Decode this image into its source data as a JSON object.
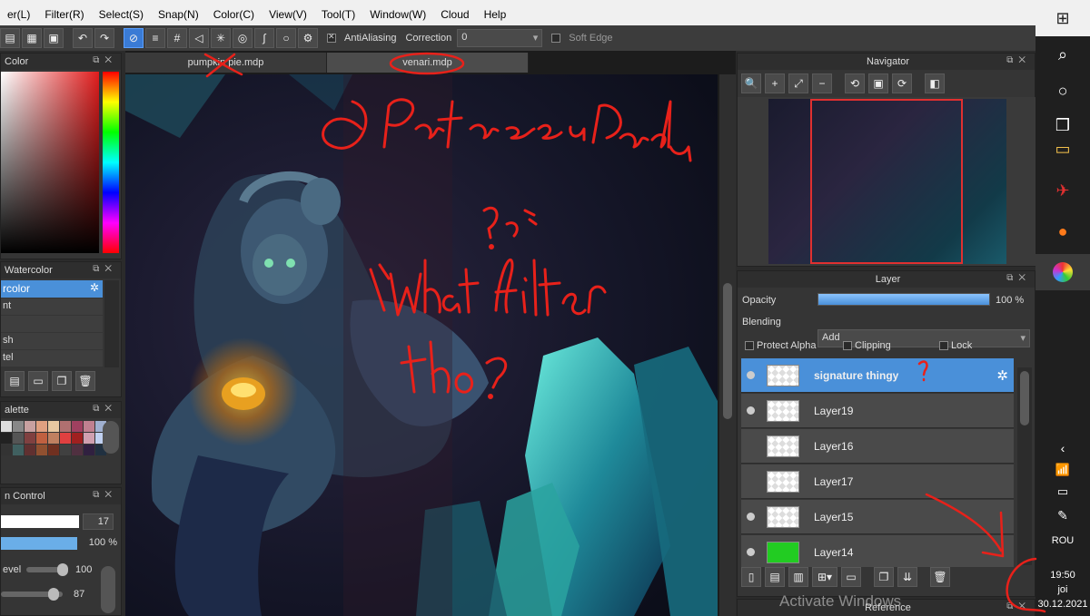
{
  "menu": [
    "er(L)",
    "Filter(R)",
    "Select(S)",
    "Snap(N)",
    "Color(C)",
    "View(V)",
    "Tool(T)",
    "Window(W)",
    "Cloud",
    "Help"
  ],
  "toolbar": {
    "antialiasing_label": "AntiAliasing",
    "correction_label": "Correction",
    "correction_value": "0",
    "soft_edge_label": "Soft Edge"
  },
  "tabs": [
    {
      "label": "pumpkin pie.mdp",
      "active": false
    },
    {
      "label": "venari.mdp",
      "active": true
    }
  ],
  "color_panel": {
    "title": "Color"
  },
  "brush_panel": {
    "title": "Watercolor",
    "items": [
      "rcolor",
      "nt",
      "",
      "sh",
      "tel"
    ]
  },
  "palette_panel": {
    "title": "alette"
  },
  "brush_control": {
    "title": "n Control",
    "size_value": "17",
    "opacity_value": "100 %",
    "level_label": "evel",
    "level_value": "100",
    "last_value": "87"
  },
  "navigator": {
    "title": "Navigator"
  },
  "layer_panel": {
    "title": "Layer",
    "opacity_label": "Opacity",
    "opacity_value": "100 %",
    "opacity_fraction": 1.0,
    "blending_label": "Blending",
    "blending_value": "Add",
    "protect_alpha_label": "Protect Alpha",
    "clipping_label": "Clipping",
    "lock_label": "Lock",
    "layers": [
      {
        "name": "signature thingy",
        "selected": true,
        "visible": true,
        "thumb": "checker"
      },
      {
        "name": "Layer19",
        "selected": false,
        "visible": true,
        "thumb": "checker"
      },
      {
        "name": "Layer16",
        "selected": false,
        "visible": false,
        "thumb": "checker"
      },
      {
        "name": "Layer17",
        "selected": false,
        "visible": false,
        "thumb": "checker"
      },
      {
        "name": "Layer15",
        "selected": false,
        "visible": true,
        "thumb": "checker"
      },
      {
        "name": "Layer14",
        "selected": false,
        "visible": true,
        "thumb": "green"
      }
    ]
  },
  "reference_panel": {
    "title": "Reference"
  },
  "watermark": "Activate Windows",
  "taskbar": {
    "lang": "ROU",
    "time": "19:50",
    "day": "joi",
    "date": "30.12.2021"
  },
  "annotations": {
    "signature": "@PatrascuRadu",
    "question": "What filter tho?"
  },
  "colors": {
    "selection_blue": "#4a90d9",
    "annotation_red": "#e8211a",
    "layer14_green": "#22cc22"
  }
}
